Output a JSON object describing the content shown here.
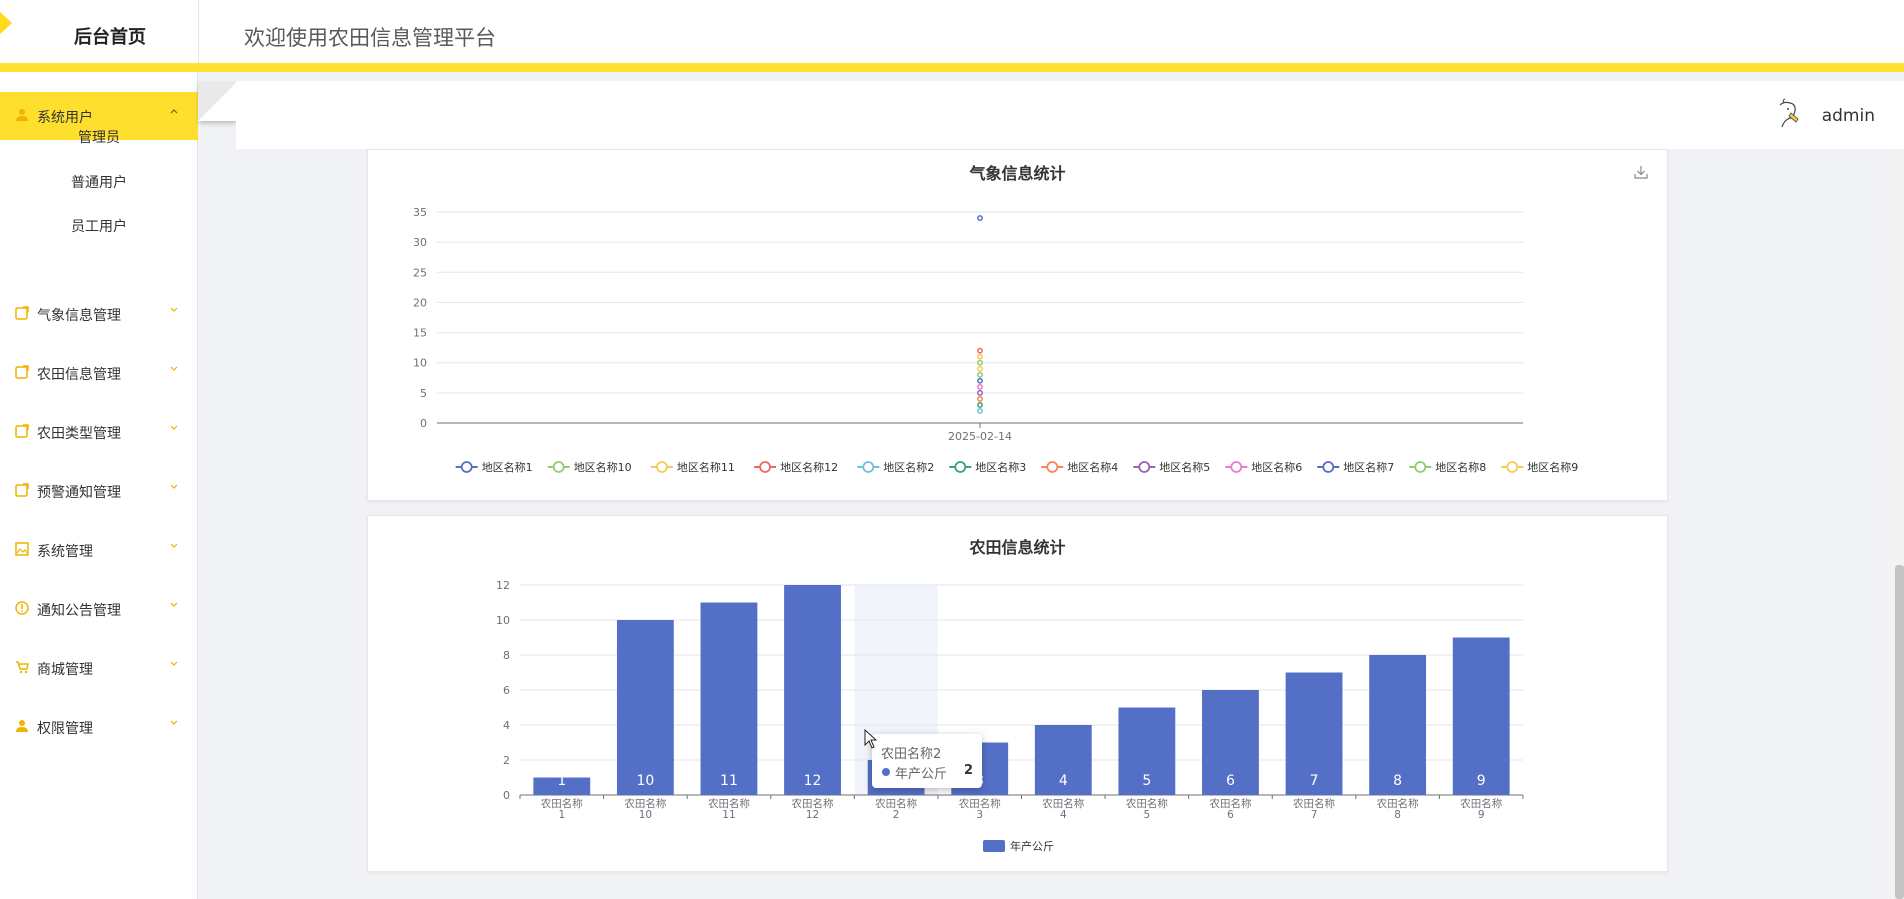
{
  "header": {
    "home_label": "后台首页",
    "platform_title": "欢迎使用农田信息管理平台"
  },
  "user": {
    "name": "admin"
  },
  "sidebar": {
    "items": [
      {
        "label": "系统用户",
        "icon": "user-icon",
        "expanded": true,
        "children": [
          {
            "label": "管理员"
          },
          {
            "label": "普通用户"
          },
          {
            "label": "员工用户"
          }
        ]
      },
      {
        "label": "气象信息管理",
        "icon": "edit-icon"
      },
      {
        "label": "农田信息管理",
        "icon": "edit-icon"
      },
      {
        "label": "农田类型管理",
        "icon": "edit-icon"
      },
      {
        "label": "预警通知管理",
        "icon": "edit-icon"
      },
      {
        "label": "系统管理",
        "icon": "image-icon"
      },
      {
        "label": "通知公告管理",
        "icon": "info-icon"
      },
      {
        "label": "商城管理",
        "icon": "cart-icon"
      },
      {
        "label": "权限管理",
        "icon": "user-icon"
      }
    ]
  },
  "colors": {
    "accent": "#ffdf2e",
    "bar": "#5470c6",
    "palette": [
      "#5470c6",
      "#91cc75",
      "#fac858",
      "#ee6666",
      "#73c0de",
      "#3ba272",
      "#fc8452",
      "#9a60b4",
      "#ea7ccc",
      "#5470c6",
      "#91cc75",
      "#fac858"
    ]
  },
  "chart_data": [
    {
      "type": "scatter",
      "title": "气象信息统计",
      "x": [
        "2025-02-14"
      ],
      "ylim": [
        0,
        35
      ],
      "yticks": [
        0,
        5,
        10,
        15,
        20,
        25,
        30,
        35
      ],
      "legend_position": "bottom",
      "series": [
        {
          "name": "地区名称1",
          "values": [
            34
          ]
        },
        {
          "name": "地区名称10",
          "values": [
            10
          ]
        },
        {
          "name": "地区名称11",
          "values": [
            11
          ]
        },
        {
          "name": "地区名称12",
          "values": [
            12
          ]
        },
        {
          "name": "地区名称2",
          "values": [
            2
          ]
        },
        {
          "name": "地区名称3",
          "values": [
            3
          ]
        },
        {
          "name": "地区名称4",
          "values": [
            4
          ]
        },
        {
          "name": "地区名称5",
          "values": [
            5
          ]
        },
        {
          "name": "地区名称6",
          "values": [
            6
          ]
        },
        {
          "name": "地区名称7",
          "values": [
            7
          ]
        },
        {
          "name": "地区名称8",
          "values": [
            8
          ]
        },
        {
          "name": "地区名称9",
          "values": [
            9
          ]
        }
      ],
      "download_icon": "download-icon"
    },
    {
      "type": "bar",
      "title": "农田信息统计",
      "categories": [
        [
          "农田名称",
          "1"
        ],
        [
          "农田名称",
          "10"
        ],
        [
          "农田名称",
          "11"
        ],
        [
          "农田名称",
          "12"
        ],
        [
          "农田名称",
          "2"
        ],
        [
          "农田名称",
          "3"
        ],
        [
          "农田名称",
          "4"
        ],
        [
          "农田名称",
          "5"
        ],
        [
          "农田名称",
          "6"
        ],
        [
          "农田名称",
          "7"
        ],
        [
          "农田名称",
          "8"
        ],
        [
          "农田名称",
          "9"
        ]
      ],
      "series": [
        {
          "name": "年产公斤",
          "values": [
            1,
            10,
            11,
            12,
            2,
            3,
            4,
            5,
            6,
            7,
            8,
            9
          ]
        }
      ],
      "ylim": [
        0,
        12
      ],
      "yticks": [
        0,
        2,
        4,
        6,
        8,
        10,
        12
      ],
      "legend_position": "bottom",
      "highlighted_category": 4,
      "tooltip": {
        "title": "农田名称2",
        "series": "年产公斤",
        "value": "2"
      }
    }
  ]
}
